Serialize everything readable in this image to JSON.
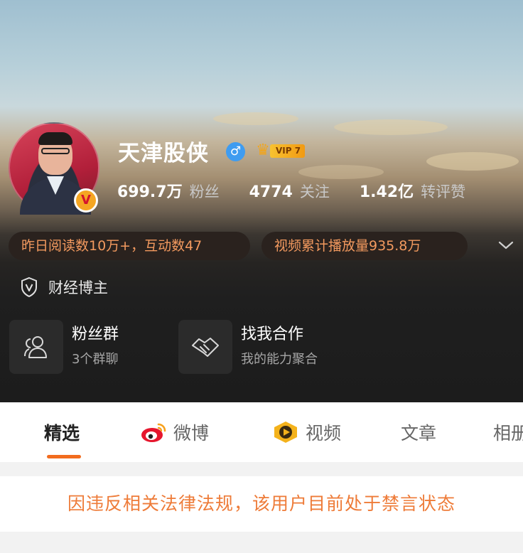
{
  "profile": {
    "name": "天津股侠",
    "vip_label": "VIP 7",
    "stats": [
      {
        "value": "699.7万",
        "label": "粉丝"
      },
      {
        "value": "4774",
        "label": "关注"
      },
      {
        "value": "1.42亿",
        "label": "转评赞"
      }
    ],
    "highlights": [
      "昨日阅读数10万+，互动数47",
      "视频累计播放量935.8万"
    ],
    "certification": "财经博主"
  },
  "cards": [
    {
      "title": "粉丝群",
      "subtitle": "3个群聊",
      "icon": "fans-group-icon"
    },
    {
      "title": "找我合作",
      "subtitle": "我的能力聚合",
      "icon": "handshake-icon"
    }
  ],
  "tabs": [
    {
      "label": "精选",
      "active": true
    },
    {
      "label": "微博",
      "icon": "weibo-icon"
    },
    {
      "label": "视频",
      "icon": "video-icon"
    },
    {
      "label": "文章"
    },
    {
      "label": "相册"
    }
  ],
  "notice": "因违反相关法律法规，该用户目前处于禁言状态",
  "colors": {
    "accent": "#f26c1e",
    "notice": "#ee7b38",
    "highlight_text": "#f39a5f",
    "verified_badge": "#f5a623",
    "gender_badge": "#3f9cf0"
  }
}
